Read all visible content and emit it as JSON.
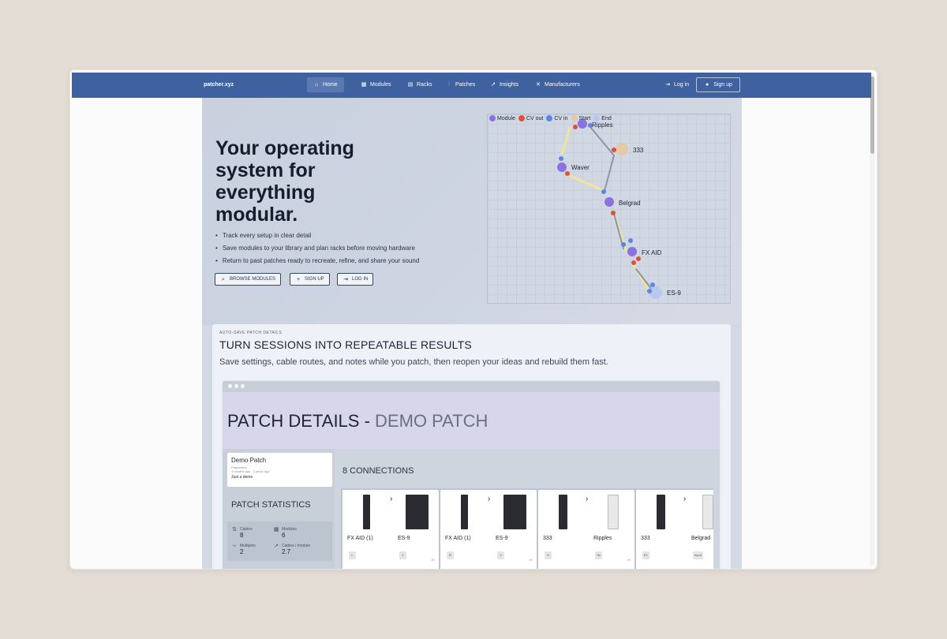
{
  "nav": {
    "brand": "patcher.xyz",
    "items": [
      {
        "label": "Home",
        "icon": "home-icon"
      },
      {
        "label": "Modules",
        "icon": "grid-icon"
      },
      {
        "label": "Racks",
        "icon": "rack-icon"
      },
      {
        "label": "Patches",
        "icon": "sliders-icon"
      },
      {
        "label": "Insights",
        "icon": "trend-icon"
      },
      {
        "label": "Manufacturers",
        "icon": "tools-icon"
      }
    ],
    "login": "Log in",
    "signup": "Sign up"
  },
  "hero": {
    "headline": "Your operating system for everything modular.",
    "bullets": [
      "Track every setup in clear detail",
      "Save modules to your library and plan racks before moving hardware",
      "Return to past patches ready to recreate, refine, and share your sound"
    ],
    "buttons": {
      "browse": "BROWSE MODULES",
      "signup": "SIGN UP",
      "login": "LOG IN"
    }
  },
  "graph": {
    "legend": [
      {
        "label": "Module",
        "color": "#8a73e0"
      },
      {
        "label": "CV out",
        "color": "#d9533e"
      },
      {
        "label": "CV in",
        "color": "#5b86e6"
      },
      {
        "label": "Start",
        "color": "#e7c8a6"
      },
      {
        "label": "End",
        "color": "#b8c6f2"
      }
    ],
    "nodes": [
      "Ripples",
      "333",
      "Waver",
      "Belgrad",
      "FX AID",
      "ES-9"
    ]
  },
  "feature": {
    "kicker": "AUTO-SAVE PATCH DETAILS",
    "title": "TURN SESSIONS INTO REPEATABLE RESULTS",
    "subtitle": "Save settings, cable routes, and notes while you patch, then reopen your ideas and rebuild them fast."
  },
  "mock": {
    "title_main": "PATCH DETAILS - ",
    "title_muted": "DEMO PATCH",
    "demo": {
      "name": "Demo Patch",
      "sub1": "Patpresbre",
      "sub2": "3 months ago · 3 years ago",
      "desc": "Just a demo"
    },
    "stats_title": "PATCH STATISTICS",
    "stats": [
      {
        "label": "Cables",
        "value": "8"
      },
      {
        "label": "Modules",
        "value": "6"
      },
      {
        "label": "Multiples",
        "value": "2"
      },
      {
        "label": "Cables / module",
        "value": "2.7"
      }
    ],
    "connections_title": "8 CONNECTIONS",
    "connections": [
      {
        "from": "FX AID",
        "from_ch": "(1)",
        "to": "ES-9",
        "tag_from": "L",
        "tag_to": "1",
        "num": "#1"
      },
      {
        "from": "FX AID",
        "from_ch": "(1)",
        "to": "ES-9",
        "tag_from": "R",
        "tag_to": "2",
        "num": "#2"
      },
      {
        "from": "333",
        "from_ch": "",
        "to": "Ripples",
        "tag_from": "I1",
        "tag_to": "IN",
        "num": "#3"
      },
      {
        "from": "333",
        "from_ch": "",
        "to": "Belgrad",
        "tag_from": "E1",
        "tag_to": "Input",
        "num": "#4"
      }
    ]
  }
}
